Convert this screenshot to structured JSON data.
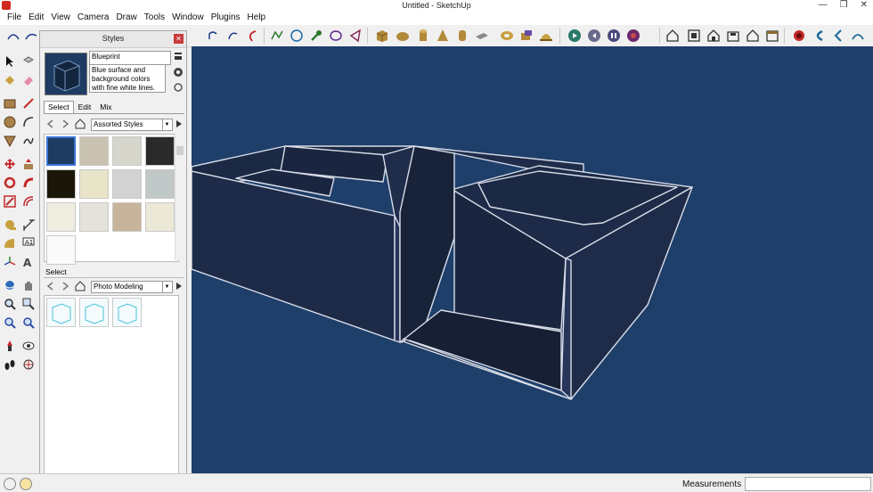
{
  "window": {
    "title": "Untitled - SketchUp",
    "controls": [
      "minimize",
      "restore",
      "close"
    ]
  },
  "menu": [
    "File",
    "Edit",
    "View",
    "Camera",
    "Draw",
    "Tools",
    "Window",
    "Plugins",
    "Help"
  ],
  "styles_panel": {
    "title": "Styles",
    "style_name": "Blueprint",
    "style_description": "Blue surface and background colors with fine white lines.",
    "tabs": [
      "Select",
      "Edit",
      "Mix"
    ],
    "active_tab": "Select",
    "library_dropdown": "Assorted Styles",
    "secondary_label": "Select",
    "secondary_dropdown": "Photo Modeling"
  },
  "viewport": {
    "background": "#1f3f6b",
    "edge_color": "#d9dde8"
  },
  "status": {
    "measurements_label": "Measurements",
    "measurements_value": ""
  },
  "colors": {
    "accent": "#3875d7",
    "close": "#c93b3b",
    "title_icon": "#d12a1f"
  }
}
